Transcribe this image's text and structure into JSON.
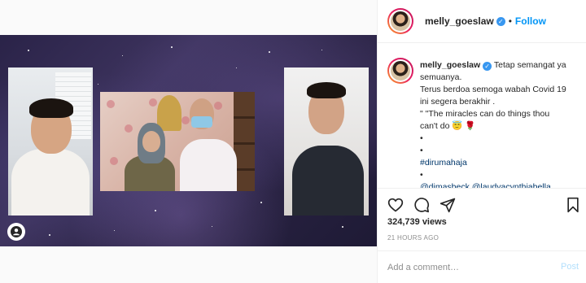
{
  "post": {
    "username": "melly_goeslaw",
    "follow_label": "Follow",
    "separator": "•"
  },
  "caption": {
    "username": "melly_goeslaw",
    "lines": [
      "Tetap semangat ya",
      "semuanya.",
      "Terus berdoa semoga wabah Covid 19",
      "ini segera berakhir .",
      "\" \"The miracles can do things thou",
      "can't do 😇 🌹",
      "•",
      "•",
      "#dirumahaja",
      "•",
      "@dimasbeck @laudyacynthiabella"
    ]
  },
  "stats": {
    "views": "324,739 views",
    "time": "21 HOURS AGO"
  },
  "comment": {
    "placeholder": "Add a comment…",
    "post_label": "Post"
  },
  "icons": {
    "like": "heart-icon",
    "comment": "comment-bubble-icon",
    "share": "send-icon",
    "save": "bookmark-icon",
    "verified": "verified-badge-icon",
    "profile_badge": "user-tag-icon"
  },
  "colors": {
    "follow_blue": "#0095f6",
    "verified_blue": "#3897f0",
    "muted_gray": "#8e8e8e",
    "link_navy": "#00376b"
  }
}
